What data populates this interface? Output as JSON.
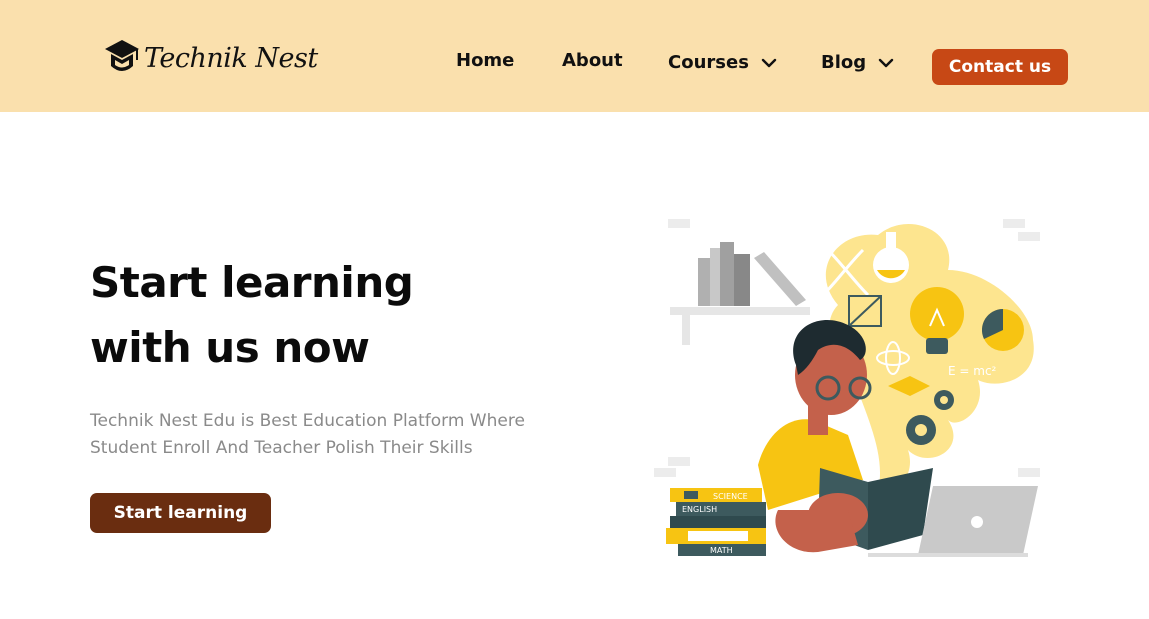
{
  "brand": {
    "name": "Technik Nest",
    "icon": "graduation-cap-icon"
  },
  "nav": {
    "home": "Home",
    "about": "About",
    "courses": "Courses",
    "blog": "Blog",
    "contact": "Contact us",
    "dropdown_icon": "chevron-down-icon"
  },
  "hero": {
    "title_line1": "Start learning",
    "title_line2": "with us now",
    "desc_line1": "Technik Nest Edu is Best Education Platform Where",
    "desc_line2": "Student Enroll And Teacher Polish Their Skills",
    "cta": "Start learning"
  },
  "illustration": {
    "books": {
      "science": "SCIENCE",
      "english": "ENGLISH",
      "math": "MATH"
    },
    "formula": "E = mc²"
  },
  "colors": {
    "header_bg": "#fae0ad",
    "contact_button": "#c74815",
    "cta_button": "#6a2d10",
    "accent_yellow": "#f7c412"
  }
}
